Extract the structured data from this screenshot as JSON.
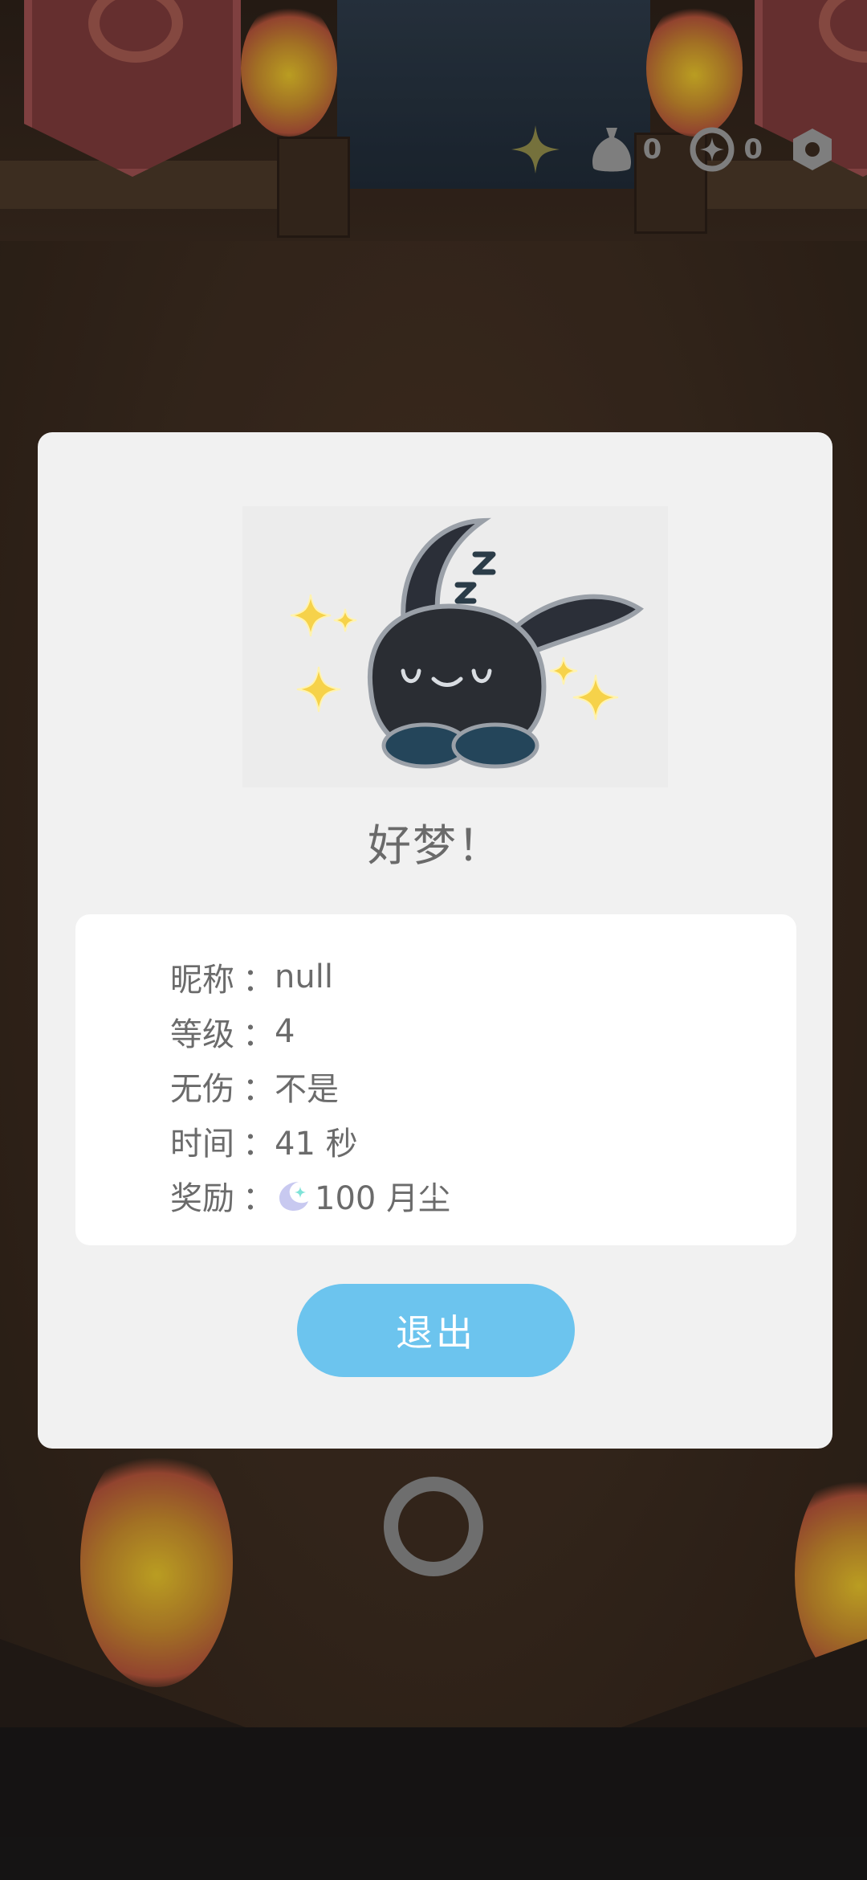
{
  "hud": {
    "star_icon": "sparkle-star-icon",
    "bag_count": "0",
    "coin_count": "0",
    "settings_icon": "hexagon-settings-icon"
  },
  "modal": {
    "title": "好梦！",
    "mascot": "sleeping-black-rabbit-with-sparkles",
    "info": [
      {
        "label": "昵称",
        "sep": "：",
        "value": "null"
      },
      {
        "label": "等级",
        "sep": "：",
        "value": "4"
      },
      {
        "label": "无伤",
        "sep": "：",
        "value": "不是"
      },
      {
        "label": "时间",
        "sep": "：",
        "value": "41 秒"
      },
      {
        "label": "奖励",
        "sep": "：",
        "value": "100 月尘",
        "icon": "moon-dust-icon"
      }
    ],
    "exit_label": "退出"
  },
  "colors": {
    "accent": "#6cc4ee",
    "modal_bg": "#f1f1f1",
    "card_bg": "#ffffff",
    "text": "#6b6b6b"
  }
}
